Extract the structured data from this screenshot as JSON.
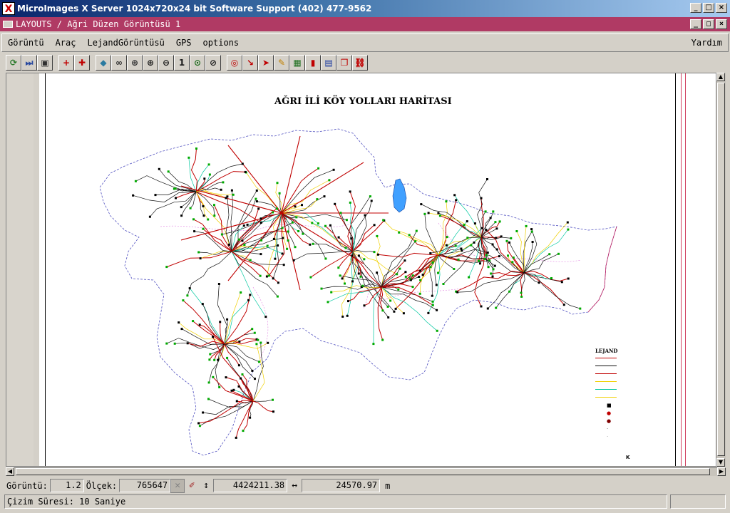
{
  "window": {
    "title": "MicroImages X Server  1024x720x24 bit  Software Support (402) 477-9562",
    "buttons": [
      "_",
      "□",
      "×"
    ]
  },
  "layout_window": {
    "title": "LAYOUTS / Ağri  Düzen Görüntüsü 1",
    "buttons": [
      "_",
      "□",
      "×"
    ]
  },
  "menu": {
    "items": [
      "Görüntü",
      "Araç",
      "LejandGörüntüsü",
      "GPS",
      "options"
    ],
    "help": "Yardım"
  },
  "toolbar": {
    "buttons": [
      {
        "icon": "redraw-icon",
        "glyph": "⟳",
        "color": "#2a7a2a"
      },
      {
        "icon": "skip-icon",
        "glyph": "⏭",
        "color": "#2a4aa0"
      },
      {
        "icon": "frame-icon",
        "glyph": "▣",
        "color": "#303030"
      },
      {
        "icon": "add-layer-icon",
        "glyph": "+",
        "color": "#c00000"
      },
      {
        "icon": "remove-layer-icon",
        "glyph": "✚",
        "color": "#c00000"
      },
      {
        "icon": "diamond-icon",
        "glyph": "◆",
        "color": "#2a7aa0"
      },
      {
        "icon": "binoculars-icon",
        "glyph": "∞",
        "color": "#303030"
      },
      {
        "icon": "zoom-region-icon",
        "glyph": "⊕",
        "color": "#303030"
      },
      {
        "icon": "zoom-in-icon",
        "glyph": "⊕",
        "color": "#1a1a1a"
      },
      {
        "icon": "zoom-out-icon",
        "glyph": "⊖",
        "color": "#1a1a1a"
      },
      {
        "icon": "zoom-1x-icon",
        "glyph": "1",
        "color": "#1a1a1a"
      },
      {
        "icon": "zoom-full-icon",
        "glyph": "⊙",
        "color": "#1a6a1a"
      },
      {
        "icon": "zoom-box-icon",
        "glyph": "⊘",
        "color": "#1a1a1a"
      },
      {
        "icon": "zoom-tool-icon",
        "glyph": "◎",
        "color": "#c00000"
      },
      {
        "icon": "select-arrow-icon",
        "glyph": "↘",
        "color": "#c00000"
      },
      {
        "icon": "pointer-icon",
        "glyph": "➤",
        "color": "#c00000"
      },
      {
        "icon": "measure-icon",
        "glyph": "✎",
        "color": "#c08000"
      },
      {
        "icon": "histogram-icon",
        "glyph": "▦",
        "color": "#207020"
      },
      {
        "icon": "bar-chart-icon",
        "glyph": "▮",
        "color": "#c00000"
      },
      {
        "icon": "layers-icon",
        "glyph": "▤",
        "color": "#1a3aa0"
      },
      {
        "icon": "copy-icon",
        "glyph": "❐",
        "color": "#c00000"
      },
      {
        "icon": "link-icon",
        "glyph": "⛓",
        "color": "#c00000"
      }
    ]
  },
  "map": {
    "title": "AĞRI İLİ KÖY YOLLARI HARİTASI",
    "legend_title": "LEJAND",
    "north_label": "K",
    "colors": {
      "road_main": "#c00000",
      "road_secondary": "#111111",
      "road_yellow": "#f0d000",
      "road_cyan": "#00c8a0",
      "border": "#5050c0",
      "district": "#e080e0",
      "lake": "#40a0ff"
    }
  },
  "status": {
    "view_label": "Görüntü:",
    "view_value": "1.2",
    "scale_label": "Ölçek:",
    "scale_value": "765647",
    "north_coord": "4424211.38",
    "east_coord": "24570.97",
    "unit": "m",
    "message": "Çizim Süresi: 10 Saniye"
  }
}
